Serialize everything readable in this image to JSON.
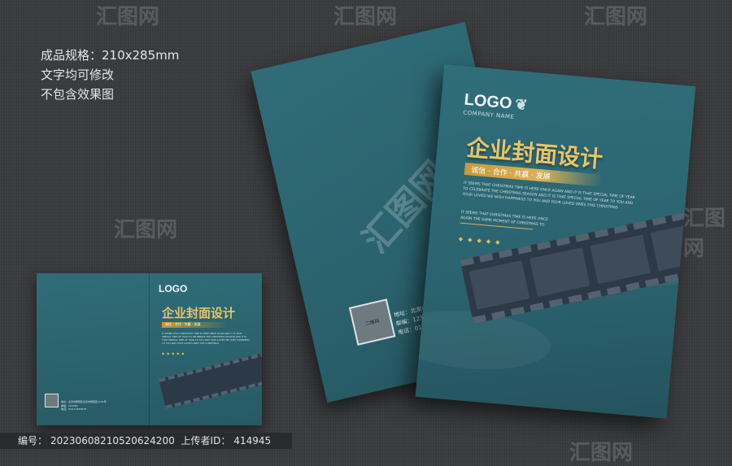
{
  "spec": {
    "line1": "成品规格：210x285mm",
    "line2": "文字均可修改",
    "line3": "不包含效果图"
  },
  "cover": {
    "logo": "LOGO",
    "company": "COMPANY NAME",
    "title": "企业封面设计",
    "slogan": "诚信 · 合作 · 共赢 · 发展",
    "english_a": "IT SEEMS THAT CHRISTMAS TIME IS HERE ONCE AGAIN AND IT IS THAT SPECIAL TIME OF YEAR TO CELEBRATE THE CHRISTMAS SEASON AND IT IS THAT SPECIAL TIME OF YEAR TO YOU AND YOUR LOVED WE WISH HAPPINESS TO YOU AND YOUR LOVED ONES THIS CHRISTMAS",
    "english_b": "IT SEEMS THAT CHRISTMAS TIME IS HERE ONCE AGAIN THE SAME MOMENT OF CHRISTMAS TO YOU AND YOUR LOVED",
    "diamonds": "◆◆◆◆◆"
  },
  "back": {
    "qr_label": "二维码",
    "contact_line1": "地址：北京市朝阳区北京市朝阳区1231号",
    "contact_line2": "邮编：123456",
    "contact_line3": "电话：010-12345678"
  },
  "watermark": {
    "text": "汇图网"
  },
  "footer": {
    "id_label": "编号：",
    "id_value": "20230608210520624200",
    "uploader_label": "上传者ID：",
    "uploader_value": "414945"
  }
}
